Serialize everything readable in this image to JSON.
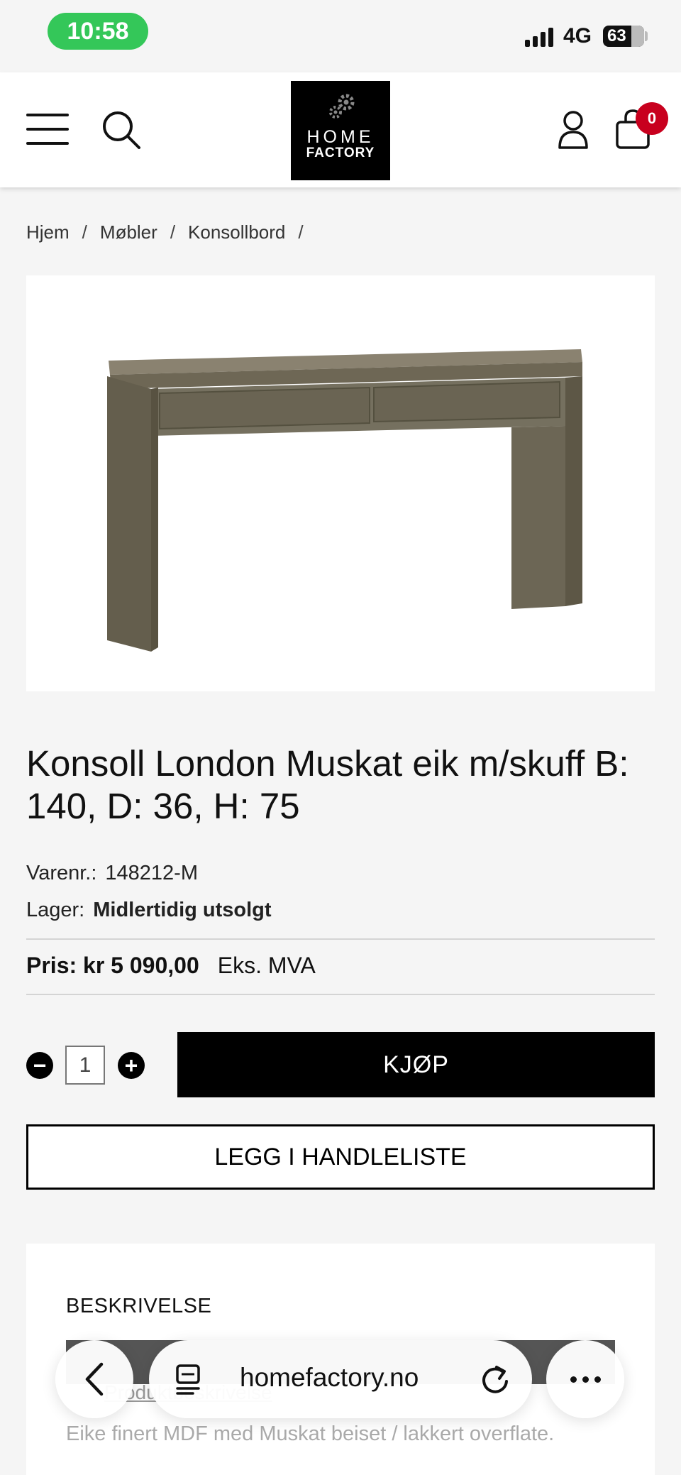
{
  "status_bar": {
    "time": "10:58",
    "network": "4G",
    "battery": "63"
  },
  "header": {
    "logo_line1": "HOME",
    "logo_line2": "FACTORY",
    "cart_count": "0"
  },
  "breadcrumb": {
    "items": [
      "Hjem",
      "Møbler",
      "Konsollbord"
    ],
    "separator": "/"
  },
  "product": {
    "title": "Konsoll London Muskat eik m/skuff B: 140, D: 36, H: 75",
    "sku_label": "Varenr.:",
    "sku": "148212-M",
    "stock_label": "Lager:",
    "stock": "Midlertidig utsolgt",
    "price_label": "Pris:",
    "price": "kr 5 090,00",
    "vat_note": "Eks. MVA",
    "quantity": "1"
  },
  "actions": {
    "minus": "−",
    "plus": "+",
    "buy_label": "KJØP",
    "list_label": "LEGG I HANDLELISTE"
  },
  "description": {
    "heading": "BESKRIVELSE",
    "tab_label": "Produktbeskrivelse",
    "text": "Eike finert MDF med Muskat beiset / lakkert overflate."
  },
  "browser": {
    "url": "homefactory.no"
  }
}
